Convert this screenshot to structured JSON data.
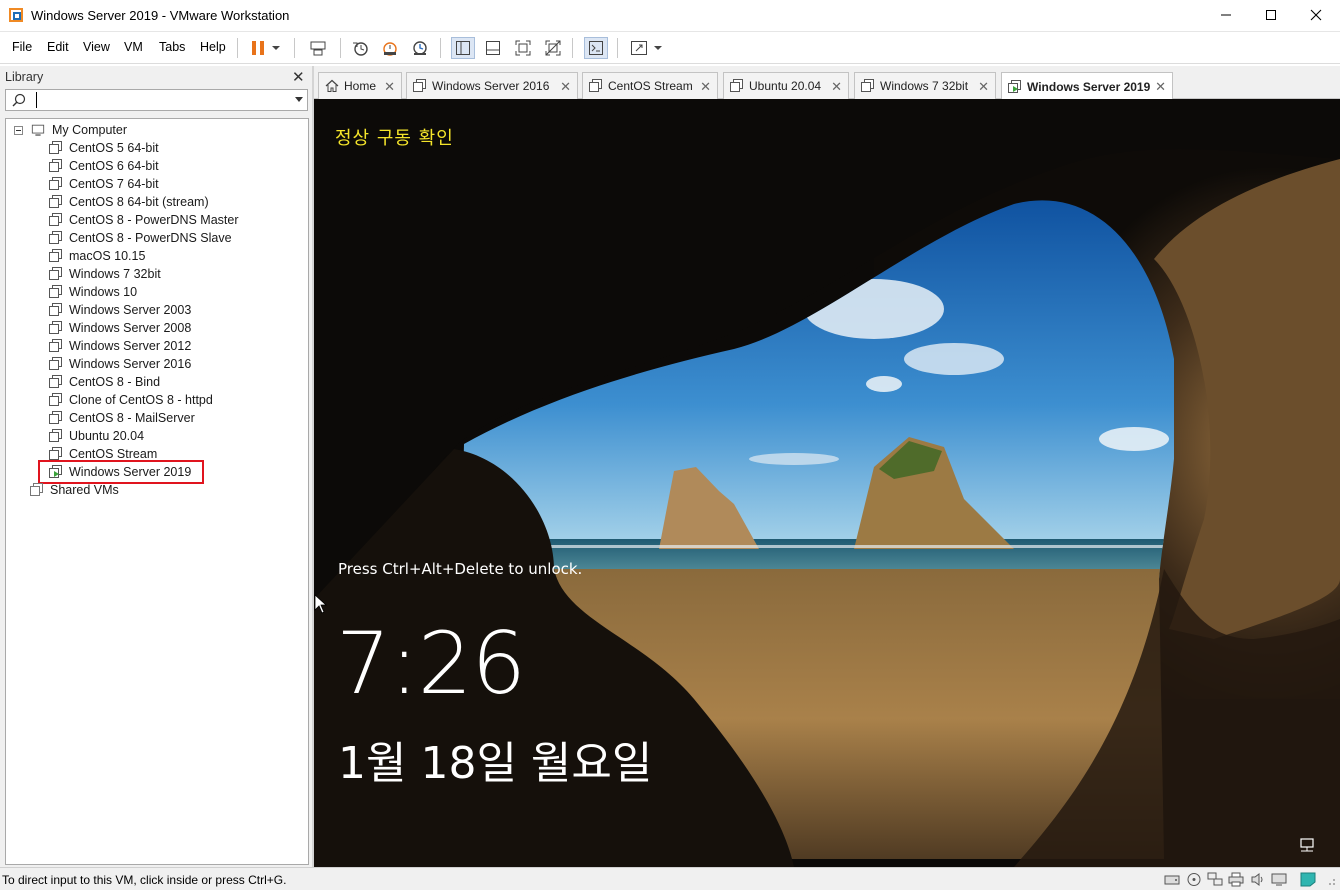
{
  "window": {
    "title": "Windows Server 2019 - VMware Workstation"
  },
  "menu": {
    "items": [
      "File",
      "Edit",
      "View",
      "VM",
      "Tabs",
      "Help"
    ]
  },
  "library": {
    "header": "Library",
    "close": "✕",
    "search_value": "",
    "root_label": "My Computer",
    "vms": [
      "CentOS 5 64-bit",
      "CentOS 6 64-bit",
      "CentOS 7 64-bit",
      "CentOS 8 64-bit (stream)",
      "CentOS 8 - PowerDNS Master",
      "CentOS 8 - PowerDNS Slave",
      "macOS 10.15",
      "Windows 7 32bit",
      "Windows 10",
      "Windows Server 2003",
      "Windows Server 2008",
      "Windows Server 2012",
      "Windows Server 2016",
      "CentOS 8 - Bind",
      "Clone of CentOS 8 - httpd",
      "CentOS 8 - MailServer",
      "Ubuntu 20.04",
      "CentOS Stream",
      "Windows Server 2019"
    ],
    "selected_vm": "Windows Server 2019",
    "shared_label": "Shared VMs"
  },
  "tabs": [
    {
      "label": "Home",
      "active": false
    },
    {
      "label": "Windows Server 2016",
      "active": false
    },
    {
      "label": "CentOS Stream",
      "active": false
    },
    {
      "label": "Ubuntu 20.04",
      "active": false
    },
    {
      "label": "Windows 7 32bit",
      "active": false
    },
    {
      "label": "Windows Server 2019",
      "active": true
    }
  ],
  "vm_screen": {
    "note": "정상 구동 확인",
    "unlock_prompt": "Press Ctrl+Alt+Delete to unlock.",
    "time": "7:26",
    "date": "1월 18일 월요일"
  },
  "statusbar": {
    "text": "To direct input to this VM, click inside or press Ctrl+G."
  },
  "colors": {
    "highlight": "#e0141e",
    "note_text": "#f5e52a",
    "pause_orange": "#e8731a"
  }
}
